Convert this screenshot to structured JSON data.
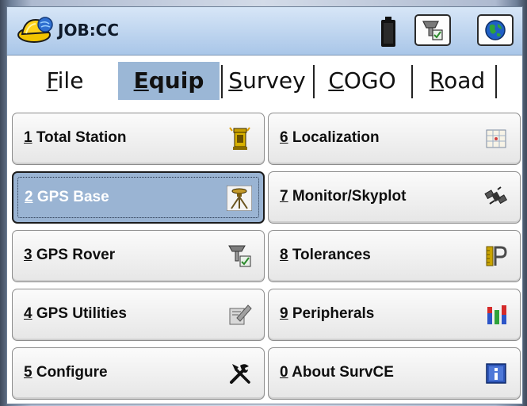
{
  "window": {
    "title": "JOB:CC",
    "icons": [
      "hardhat-logo-icon",
      "battery-icon",
      "instrument-config-icon",
      "globe-icon"
    ]
  },
  "menu": {
    "active_tab": "Equip",
    "tabs": [
      {
        "label": "File",
        "mnemonic": "F",
        "rest": "ile"
      },
      {
        "label": "Equip",
        "mnemonic": "E",
        "rest": "quip"
      },
      {
        "label": "Survey",
        "mnemonic": "S",
        "rest": "urvey"
      },
      {
        "label": "COGO",
        "mnemonic": "C",
        "rest": "OGO"
      },
      {
        "label": "Road",
        "mnemonic": "R",
        "rest": "oad"
      }
    ]
  },
  "buttons": [
    {
      "num": "1",
      "text": " Total Station",
      "icon": "total-station-icon"
    },
    {
      "num": "2",
      "text": " GPS Base",
      "icon": "gps-base-icon",
      "selected": true
    },
    {
      "num": "3",
      "text": " GPS Rover",
      "icon": "gps-rover-icon"
    },
    {
      "num": "4",
      "text": " GPS Utilities",
      "icon": "gps-utilities-icon"
    },
    {
      "num": "5",
      "text": " Configure",
      "icon": "tools-icon"
    },
    {
      "num": "6",
      "text": " Localization",
      "icon": "localization-grid-icon"
    },
    {
      "num": "7",
      "text": " Monitor/Skyplot",
      "icon": "satellite-icon"
    },
    {
      "num": "8",
      "text": " Tolerances",
      "icon": "tolerance-icon"
    },
    {
      "num": "9",
      "text": " Peripherals",
      "icon": "peripherals-icon"
    },
    {
      "num": "0",
      "text": " About SurvCE",
      "icon": "info-icon"
    }
  ],
  "colors": {
    "selected_button": "#9ab4d3",
    "active_tab": "#9bb7d6",
    "titlebar": "#a9c6e8"
  }
}
